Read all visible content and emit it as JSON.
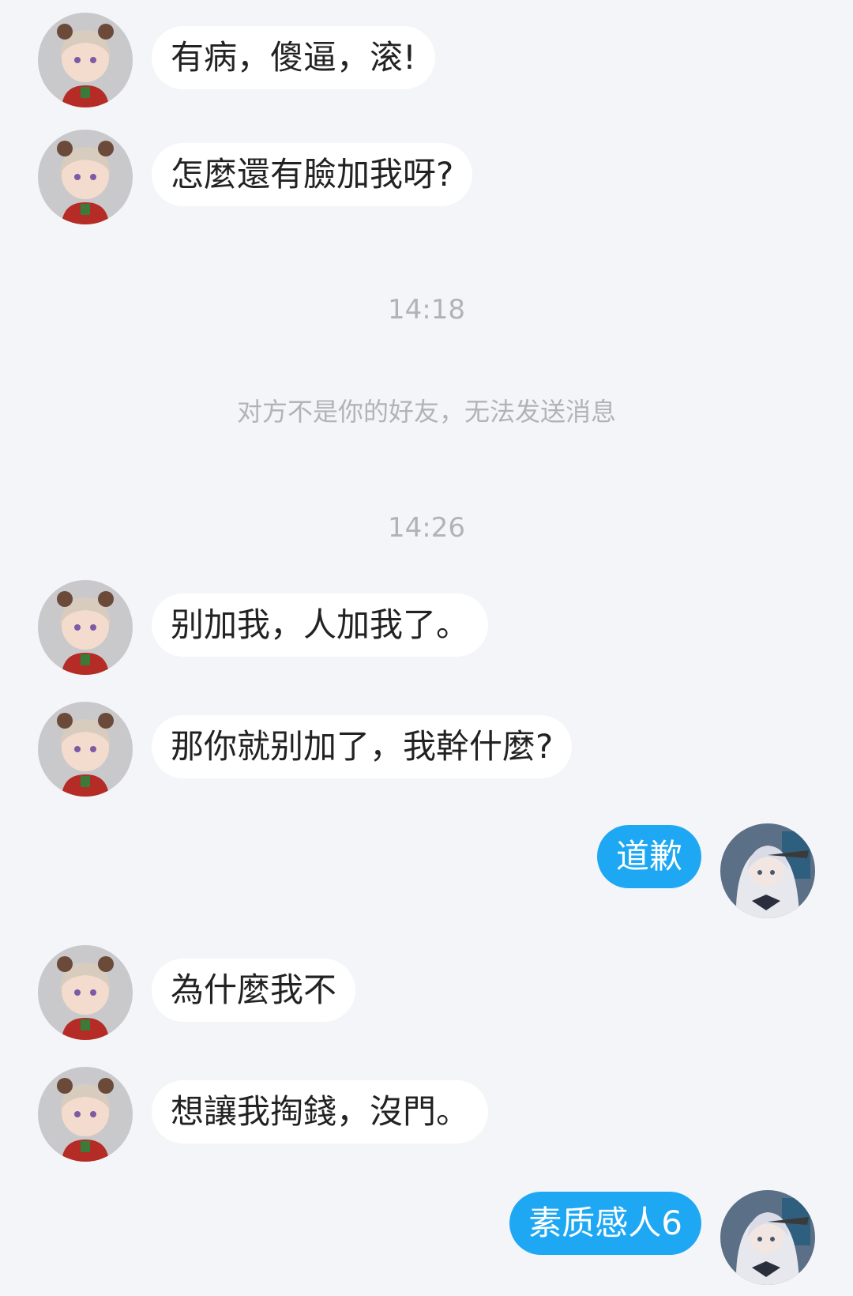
{
  "colors": {
    "background": "#f4f5f8",
    "incoming_bubble": "#ffffff",
    "outgoing_bubble": "#1ea8f4",
    "system_text": "#b1b3b8"
  },
  "messages": [
    {
      "side": "left",
      "text": "有病，傻逼，滚!"
    },
    {
      "side": "left",
      "text": "怎麼還有臉加我呀?"
    },
    {
      "time": "14:18"
    },
    {
      "notice": "对方不是你的好友，无法发送消息"
    },
    {
      "time": "14:26"
    },
    {
      "side": "left",
      "text": "别加我，人加我了。"
    },
    {
      "side": "left",
      "text": "那你就别加了，我幹什麼?"
    },
    {
      "side": "right",
      "text": "道歉"
    },
    {
      "side": "left",
      "text": "為什麼我不"
    },
    {
      "side": "left",
      "text": "想讓我掏錢，沒門。"
    },
    {
      "side": "right",
      "text": "素质感人6"
    }
  ]
}
